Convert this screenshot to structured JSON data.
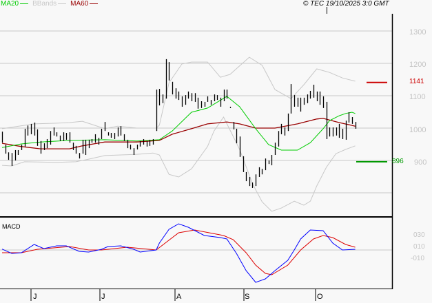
{
  "header": {
    "legend": [
      {
        "label": "MA20",
        "color": "#00cc00"
      },
      {
        "label": "BBands",
        "color": "#c8c8c8"
      },
      {
        "label": "MA60",
        "color": "#990000"
      }
    ],
    "copyright": "© TEC 19/10/2025 3:0 GMT"
  },
  "chart_data": [
    {
      "type": "ohlc-bar",
      "title": "",
      "ylim": [
        750,
        1350
      ],
      "y_ticks": [
        "1300",
        "1200",
        "1100",
        "1000",
        "900"
      ],
      "y_tick_values": [
        1300,
        1200,
        1100,
        1000,
        900
      ],
      "x_tick_labels": [
        "J",
        "J",
        "A",
        "S",
        "O"
      ],
      "grid": true,
      "bars_high_low": [
        [
          989,
          955
        ],
        [
          949,
          921
        ],
        [
          925,
          902
        ],
        [
          923,
          883
        ],
        [
          932,
          900
        ],
        [
          932,
          917
        ],
        [
          949,
          932
        ],
        [
          998,
          943
        ],
        [
          1008,
          977
        ],
        [
          1013,
          981
        ],
        [
          1017,
          977
        ],
        [
          996,
          945
        ],
        [
          960,
          921
        ],
        [
          953,
          932
        ],
        [
          966,
          938
        ],
        [
          991,
          949
        ],
        [
          1002,
          977
        ],
        [
          987,
          974
        ],
        [
          977,
          960
        ],
        [
          987,
          960
        ],
        [
          985,
          964
        ],
        [
          987,
          955
        ],
        [
          955,
          932
        ],
        [
          945,
          921
        ],
        [
          923,
          906
        ],
        [
          964,
          921
        ],
        [
          964,
          917
        ],
        [
          964,
          938
        ],
        [
          966,
          955
        ],
        [
          981,
          955
        ],
        [
          970,
          949
        ],
        [
          998,
          966
        ],
        [
          1019,
          991
        ],
        [
          987,
          977
        ],
        [
          985,
          970
        ],
        [
          985,
          966
        ],
        [
          1002,
          974
        ],
        [
          1006,
          977
        ],
        [
          981,
          960
        ],
        [
          964,
          938
        ],
        [
          949,
          934
        ],
        [
          938,
          917
        ],
        [
          949,
          934
        ],
        [
          960,
          943
        ],
        [
          966,
          949
        ],
        [
          960,
          943
        ],
        [
          964,
          945
        ],
        [
          966,
          949
        ],
        [
          1119,
          991
        ],
        [
          1121,
          1070
        ],
        [
          1104,
          1077
        ],
        [
          1213,
          1091
        ],
        [
          1204,
          1147
        ],
        [
          1143,
          1104
        ],
        [
          1123,
          1091
        ],
        [
          1113,
          1087
        ],
        [
          1098,
          1066
        ],
        [
          1102,
          1072
        ],
        [
          1113,
          1091
        ],
        [
          1108,
          1083
        ],
        [
          1108,
          1081
        ],
        [
          1094,
          1060
        ],
        [
          1083,
          1062
        ],
        [
          1081,
          1066
        ],
        [
          1098,
          1081
        ],
        [
          1087,
          1072
        ],
        [
          1104,
          1083
        ],
        [
          1102,
          1087
        ],
        [
          1094,
          1066
        ],
        [
          1119,
          1083
        ],
        [
          1119,
          1091
        ],
        [
          1066,
          1062
        ],
        [
          1019,
          996
        ],
        [
          998,
          953
        ],
        [
          974,
          911
        ],
        [
          913,
          864
        ],
        [
          864,
          836
        ],
        [
          849,
          821
        ],
        [
          832,
          815
        ],
        [
          857,
          821
        ],
        [
          879,
          849
        ],
        [
          874,
          857
        ],
        [
          906,
          870
        ],
        [
          900,
          889
        ],
        [
          917,
          885
        ],
        [
          955,
          917
        ],
        [
          991,
          943
        ],
        [
          1013,
          981
        ],
        [
          1002,
          977
        ],
        [
          1045,
          991
        ],
        [
          1136,
          1045
        ],
        [
          1102,
          1066
        ],
        [
          1094,
          1066
        ],
        [
          1094,
          1051
        ],
        [
          1094,
          1072
        ],
        [
          1104,
          1077
        ],
        [
          1115,
          1091
        ],
        [
          1134,
          1094
        ],
        [
          1113,
          1083
        ],
        [
          1113,
          1072
        ],
        [
          1098,
          1062
        ],
        [
          1081,
          966
        ],
        [
          1002,
          974
        ],
        [
          1002,
          974
        ],
        [
          1002,
          977
        ],
        [
          1013,
          970
        ],
        [
          998,
          966
        ],
        [
          1023,
          964
        ],
        [
          1049,
          1017
        ],
        [
          1034,
          1013
        ],
        [
          1019,
          998
        ]
      ],
      "series": [
        {
          "name": "MA20",
          "color": "#00cc00",
          "points": [
            [
              0,
              940
            ],
            [
              6,
              951
            ],
            [
              12,
              957
            ],
            [
              21,
              962
            ],
            [
              32,
              964
            ],
            [
              42,
              960
            ],
            [
              49,
              964
            ],
            [
              53,
              991
            ],
            [
              59,
              1049
            ],
            [
              64,
              1062
            ],
            [
              70,
              1098
            ],
            [
              74,
              1066
            ],
            [
              79,
              998
            ],
            [
              83,
              949
            ],
            [
              87,
              932
            ],
            [
              92,
              932
            ],
            [
              96,
              955
            ],
            [
              100,
              998
            ],
            [
              102,
              1023
            ],
            [
              105,
              1038
            ],
            [
              107,
              1045
            ],
            [
              109,
              1049
            ],
            [
              110,
              1045
            ]
          ]
        },
        {
          "name": "MA60",
          "color": "#990000",
          "points": [
            [
              0,
              953
            ],
            [
              6,
              943
            ],
            [
              12,
              936
            ],
            [
              21,
              936
            ],
            [
              25,
              945
            ],
            [
              32,
              957
            ],
            [
              42,
              957
            ],
            [
              49,
              962
            ],
            [
              53,
              981
            ],
            [
              59,
              998
            ],
            [
              64,
              1013
            ],
            [
              70,
              1019
            ],
            [
              74,
              1013
            ],
            [
              79,
              1000
            ],
            [
              85,
              1000
            ],
            [
              92,
              1013
            ],
            [
              98,
              1028
            ],
            [
              100,
              1030
            ],
            [
              105,
              1017
            ],
            [
              110,
              1006
            ]
          ]
        },
        {
          "name": "BBands",
          "color": "#c8c8c8",
          "upper": [
            [
              0,
              998
            ],
            [
              10,
              1013
            ],
            [
              17,
              1015
            ],
            [
              21,
              1017
            ],
            [
              25,
              1021
            ],
            [
              32,
              998
            ],
            [
              36,
              1006
            ],
            [
              42,
              1000
            ],
            [
              48,
              1000
            ],
            [
              49,
              1009
            ],
            [
              52,
              1140
            ],
            [
              56,
              1198
            ],
            [
              59,
              1204
            ],
            [
              64,
              1204
            ],
            [
              68,
              1157
            ],
            [
              71,
              1166
            ],
            [
              77,
              1219
            ],
            [
              81,
              1194
            ],
            [
              85,
              1119
            ],
            [
              90,
              1091
            ],
            [
              94,
              1134
            ],
            [
              98,
              1183
            ],
            [
              102,
              1172
            ],
            [
              106,
              1155
            ],
            [
              110,
              1145
            ]
          ],
          "lower": [
            [
              0,
              885
            ],
            [
              3,
              883
            ],
            [
              7,
              896
            ],
            [
              17,
              894
            ],
            [
              23,
              896
            ],
            [
              27,
              904
            ],
            [
              32,
              915
            ],
            [
              42,
              919
            ],
            [
              47,
              923
            ],
            [
              49,
              917
            ],
            [
              52,
              857
            ],
            [
              55,
              849
            ],
            [
              59,
              874
            ],
            [
              64,
              943
            ],
            [
              66,
              991
            ],
            [
              69,
              1034
            ],
            [
              74,
              934
            ],
            [
              78,
              828
            ],
            [
              81,
              772
            ],
            [
              84,
              743
            ],
            [
              87,
              753
            ],
            [
              91,
              774
            ],
            [
              94,
              762
            ],
            [
              96,
              774
            ],
            [
              98,
              821
            ],
            [
              101,
              879
            ],
            [
              104,
              921
            ],
            [
              107,
              934
            ],
            [
              110,
              945
            ]
          ]
        }
      ],
      "reference_lines": [
        {
          "label": "1141",
          "value": 1141,
          "color": "#cc0000"
        },
        {
          "label": "896",
          "value": 896,
          "color": "#009900"
        }
      ]
    },
    {
      "type": "line",
      "title": "MACD",
      "y_ticks": [
        "030",
        "010",
        "-010"
      ],
      "series": [
        {
          "color": "#0000ff",
          "points": [
            [
              0,
              1.5
            ],
            [
              3,
              -5.9
            ],
            [
              6,
              -4.7
            ],
            [
              10,
              9.4
            ],
            [
              13,
              2.4
            ],
            [
              17,
              7.1
            ],
            [
              20,
              7.1
            ],
            [
              24,
              -2.4
            ],
            [
              27,
              -3.5
            ],
            [
              31,
              1.2
            ],
            [
              33,
              5.9
            ],
            [
              37,
              7.1
            ],
            [
              41,
              1.2
            ],
            [
              43,
              -3.5
            ],
            [
              48,
              0
            ],
            [
              49,
              11.8
            ],
            [
              52,
              35.3
            ],
            [
              55,
              44.7
            ],
            [
              58,
              38.8
            ],
            [
              63,
              24.7
            ],
            [
              68,
              21.2
            ],
            [
              70,
              18.8
            ],
            [
              73,
              -5.9
            ],
            [
              76,
              -35.3
            ],
            [
              79,
              -55.3
            ],
            [
              82,
              -49.4
            ],
            [
              85,
              -35.3
            ],
            [
              89,
              -17.6
            ],
            [
              91,
              0
            ],
            [
              93,
              18.8
            ],
            [
              96,
              34.1
            ],
            [
              100,
              32.9
            ],
            [
              103,
              11.8
            ],
            [
              106,
              0
            ],
            [
              110,
              1.2
            ]
          ]
        },
        {
          "color": "#dd0000",
          "points": [
            [
              0,
              -4.7
            ],
            [
              6,
              -4.7
            ],
            [
              11,
              1.2
            ],
            [
              21,
              5.9
            ],
            [
              27,
              0
            ],
            [
              31,
              0
            ],
            [
              39,
              4.7
            ],
            [
              48,
              0
            ],
            [
              55,
              29.4
            ],
            [
              60,
              34.1
            ],
            [
              69,
              24.7
            ],
            [
              72,
              17.6
            ],
            [
              76,
              -4.7
            ],
            [
              79,
              -25.9
            ],
            [
              82,
              -40
            ],
            [
              84,
              -42.4
            ],
            [
              89,
              -25.9
            ],
            [
              93,
              0
            ],
            [
              97,
              18.8
            ],
            [
              100,
              24.7
            ],
            [
              103,
              21.2
            ],
            [
              107,
              9.4
            ],
            [
              110,
              4.7
            ]
          ]
        }
      ]
    }
  ]
}
